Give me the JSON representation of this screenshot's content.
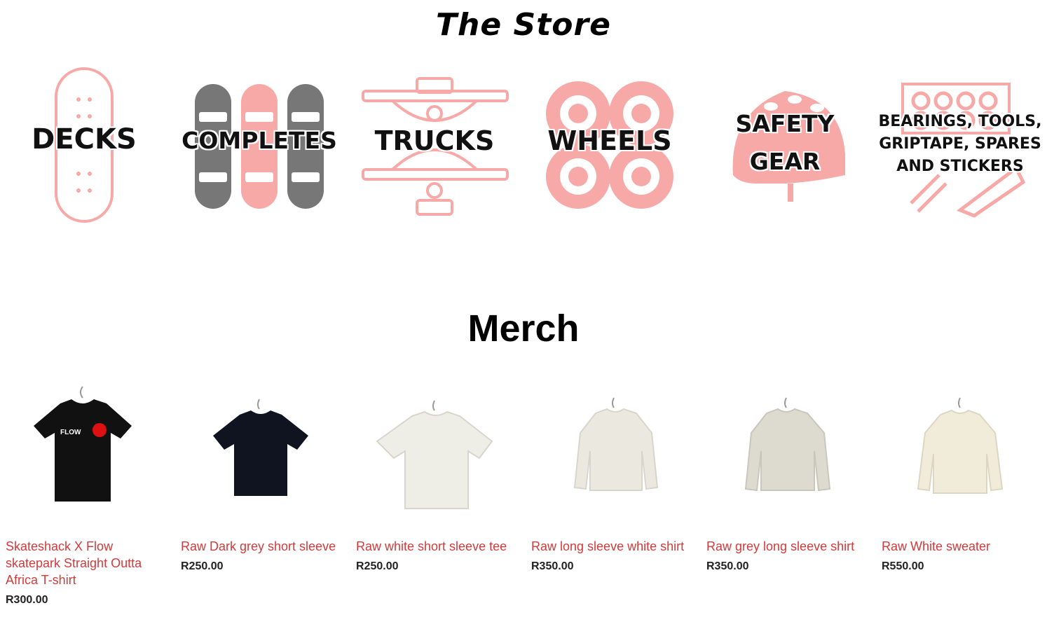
{
  "store": {
    "title": "The Store",
    "categories": [
      {
        "label": "DECKS",
        "icon": "skateboard-deck-icon"
      },
      {
        "label": "COMPLETES",
        "icon": "complete-skateboards-icon"
      },
      {
        "label": "TRUCKS",
        "icon": "truck-icon"
      },
      {
        "label": "WHEELS",
        "icon": "wheels-icon"
      },
      {
        "label_line1": "SAFETY",
        "label_line2": "GEAR",
        "icon": "helmet-icon"
      },
      {
        "label_line1": "BEARINGS, TOOLS,",
        "label_line2": "GRIPTAPE, SPARES",
        "label_line3": "AND STICKERS",
        "icon": "bearings-tools-icon"
      }
    ]
  },
  "merch": {
    "title": "Merch",
    "products": [
      {
        "name": "Skateshack X Flow skatepark Straight Outta Africa T-shirt",
        "price": "R300.00",
        "icon": "black-tshirt-icon",
        "print_text": "FLOW"
      },
      {
        "name": "Raw Dark grey short sleeve",
        "price": "R250.00",
        "icon": "dark-tshirt-icon"
      },
      {
        "name": "Raw white short sleeve tee",
        "price": "R250.00",
        "icon": "white-tshirt-icon"
      },
      {
        "name": "Raw long sleeve white shirt",
        "price": "R350.00",
        "icon": "white-longsleeve-icon"
      },
      {
        "name": "Raw grey long sleeve shirt",
        "price": "R350.00",
        "icon": "grey-longsleeve-icon"
      },
      {
        "name": "Raw White sweater",
        "price": "R550.00",
        "icon": "white-sweater-icon"
      }
    ]
  },
  "colors": {
    "accent_pink": "#f7a9a8",
    "accent_grey": "#777777",
    "link_red": "#d23b3b",
    "text_dark": "#222222"
  }
}
